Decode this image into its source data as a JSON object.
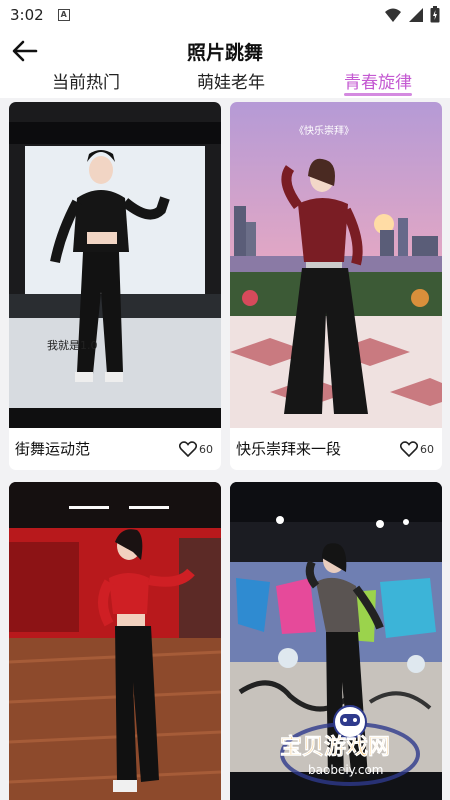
{
  "status_bar": {
    "time": "3:02",
    "notification_icon": "A"
  },
  "header": {
    "title": "照片跳舞"
  },
  "tabs": [
    {
      "label": "当前热门",
      "active": false
    },
    {
      "label": "萌娃老年",
      "active": false
    },
    {
      "label": "青春旋律",
      "active": true
    }
  ],
  "cards": [
    {
      "title": "街舞运动范",
      "likes": "60",
      "caption": "我就是1.0"
    },
    {
      "title": "快乐崇拜来一段",
      "likes": "60",
      "overlay_text": "《快乐崇拜》"
    },
    {
      "title": "",
      "likes": ""
    },
    {
      "title": "",
      "likes": ""
    }
  ],
  "watermark": {
    "name": "宝贝游戏网",
    "url": "baobeiy.com"
  },
  "colors": {
    "accent": "#c45ad2",
    "underline": "#d48ae0"
  }
}
